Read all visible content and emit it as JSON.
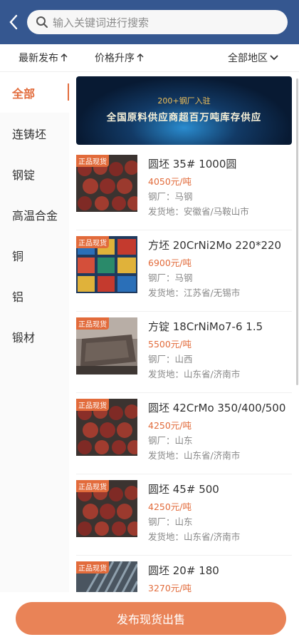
{
  "header": {
    "search_placeholder": "输入关键词进行搜索"
  },
  "filters": {
    "latest": "最新发布",
    "price": "价格升序",
    "region": "全部地区"
  },
  "categories": [
    "全部",
    "连铸坯",
    "钢锭",
    "高温合金",
    "铜",
    "铝",
    "锻材"
  ],
  "banner": {
    "line1": "200+钢厂入驻",
    "line2": "全国原料供应商超百万吨库存供应"
  },
  "products": [
    {
      "badge": "正品现货",
      "title": "圆坯 35# 1000圆",
      "price": "4050元/吨",
      "mill": "钢厂：马钢",
      "origin": "发货地：安徽省/马鞍山市"
    },
    {
      "badge": "正品现货",
      "title": "方坯 20CrNi2Mo 220*220",
      "price": "6900元/吨",
      "mill": "钢厂：马钢",
      "origin": "发货地：江苏省/无锡市"
    },
    {
      "badge": "正品现货",
      "title": "方锭 18CrNiMo7-6 1.5",
      "price": "5500元/吨",
      "mill": "钢厂：山西",
      "origin": "发货地：山东省/济南市"
    },
    {
      "badge": "正品现货",
      "title": "圆坯 42CrMo 350/400/500",
      "price": "4250元/吨",
      "mill": "钢厂：山东",
      "origin": "发货地：山东省/济南市"
    },
    {
      "badge": "正品现货",
      "title": "圆坯 45# 500",
      "price": "4250元/吨",
      "mill": "钢厂：山东",
      "origin": "发货地：山东省/济南市"
    },
    {
      "badge": "正品现货",
      "title": "圆坯 20# 180",
      "price": "3270元/吨",
      "mill": "",
      "origin": ""
    }
  ],
  "bottom": {
    "publish_label": "发布现货出售"
  }
}
